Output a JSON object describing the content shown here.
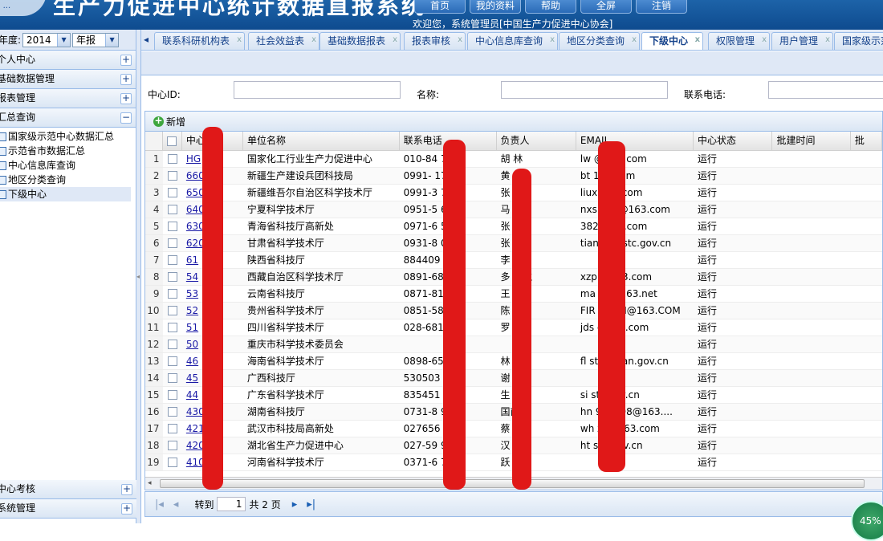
{
  "header": {
    "logo_text": "...",
    "app_title": "生产力促进中心统计数据直报系统",
    "welcome": "欢迎您，系统管理员[中国生产力促进中心协会]",
    "buttons": [
      "首页",
      "我的资料",
      "帮助",
      "全屏",
      "注销"
    ]
  },
  "sidebar": {
    "year_label": "年度:",
    "year_value": "2014",
    "report_type": "年报",
    "sections_top": [
      "个人中心",
      "基础数据管理",
      "报表管理",
      "汇总查询"
    ],
    "tree_items": [
      "国家级示范中心数据汇总",
      "示范省市数据汇总",
      "中心信息库查询",
      "地区分类查询",
      "下级中心"
    ],
    "selected_item": "下级中心",
    "sections_bottom": [
      "中心考核",
      "系统管理"
    ]
  },
  "tabs": [
    "联系科研机构表",
    "社会效益表",
    "基础数据报表",
    "报表审核",
    "中心信息库查询",
    "地区分类查询",
    "下级中心",
    "权限管理",
    "用户管理",
    "国家级示范"
  ],
  "active_tab": "下级中心",
  "search": {
    "id_label": "中心ID:",
    "name_label": "名称:",
    "phone_label": "联系电话:"
  },
  "toolbar": {
    "add_label": "新增"
  },
  "grid": {
    "columns": [
      "中心",
      "单位名称",
      "联系电话",
      "负责人",
      "EMAIL",
      "中心状态",
      "批建时间",
      "批"
    ],
    "rows": [
      {
        "n": "1",
        "id": "HG",
        "name": "国家化工行业生产力促进中心",
        "phone": "010-84 721",
        "person": "胡 林",
        "email": "lw @sina.com",
        "status": "运行"
      },
      {
        "n": "2",
        "id": "660",
        "name": "新疆生产建设兵团科技局",
        "phone": "0991- 170",
        "person": "黄",
        "email": "bt 126.com",
        "status": "运行"
      },
      {
        "n": "3",
        "id": "650",
        "name": "新疆维吾尔自治区科学技术厅",
        "phone": "0991-3 741",
        "person": "张 雷",
        "email": "liux 163.com",
        "status": "运行"
      },
      {
        "n": "4",
        "id": "640",
        "name": "宁夏科学技术厅",
        "phone": "0951-5 687",
        "person": "马 贵",
        "email": "nxs 821@163.com",
        "status": "运行"
      },
      {
        "n": "5",
        "id": "630",
        "name": "青海省科技厅高新处",
        "phone": "0971-6 505",
        "person": "张 满",
        "email": "382 @qq.com",
        "status": "运行"
      },
      {
        "n": "6",
        "id": "620",
        "name": "甘肃省科学技术厅",
        "phone": "0931-8 031",
        "person": "张 理",
        "email": "tian @gsstc.gov.cn",
        "status": "运行"
      },
      {
        "n": "7",
        "id": "61",
        "name": "陕西省科技厅",
        "phone": "884409",
        "person": "李 远",
        "email": "",
        "status": "运行"
      },
      {
        "n": "8",
        "id": "54",
        "name": "西藏自治区科学技术厅",
        "phone": "0891-68 71",
        "person": "多 次仁",
        "email": "xzp @163.com",
        "status": "运行"
      },
      {
        "n": "9",
        "id": "53",
        "name": "云南省科技厅",
        "phone": "0871-81 05",
        "person": "王 华",
        "email": "ma uy@163.net",
        "status": "运行"
      },
      {
        "n": "10",
        "id": "52",
        "name": "贵州省科学技术厅",
        "phone": "0851-584 32",
        "person": "陈",
        "email": "FIR EMCN@163.COM",
        "status": "运行"
      },
      {
        "n": "11",
        "id": "51",
        "name": "四川省科学技术厅",
        "phone": "028-681 39",
        "person": "罗 平",
        "email": "jds @163.com",
        "status": "运行"
      },
      {
        "n": "12",
        "id": "50",
        "name": "重庆市科学技术委员会",
        "phone": "",
        "person": "",
        "email": "",
        "status": "运行"
      },
      {
        "n": "13",
        "id": "46",
        "name": "海南省科学技术厅",
        "phone": "0898-65 525",
        "person": "林 梁",
        "email": "fl st.hainan.gov.cn",
        "status": "运行"
      },
      {
        "n": "14",
        "id": "45",
        "name": "广西科技厅",
        "phone": "530503",
        "person": "谢 堂",
        "email": "",
        "status": "运行"
      },
      {
        "n": "15",
        "id": "44",
        "name": "广东省科学技术厅",
        "phone": "835451 925",
        "person": "生",
        "email": "si stc.gov.cn",
        "status": "运行"
      },
      {
        "n": "16",
        "id": "430",
        "name": "湖南省科技厅",
        "phone": "0731-8 98",
        "person": "国甫",
        "email": "hn 988998@163....",
        "status": "运行"
      },
      {
        "n": "17",
        "id": "421",
        "name": "武汉市科技局高新处",
        "phone": "027656 30",
        "person": "蔡 学",
        "email": "wh zx@163.com",
        "status": "运行"
      },
      {
        "n": "18",
        "id": "420",
        "name": "湖北省生产力促进中心",
        "phone": "027-59 91",
        "person": "汉",
        "email": "ht std.gov.cn",
        "status": "运行"
      },
      {
        "n": "19",
        "id": "410",
        "name": "河南省科学技术厅",
        "phone": "0371-6 717",
        "person": "跃",
        "email": "",
        "status": "运行"
      }
    ]
  },
  "pager": {
    "goto_label": "转到",
    "page_value": "1",
    "total_label": "共 2 页"
  },
  "zoom": "45%",
  "colors": {
    "accent": "#1d63a8",
    "panel": "#dfe8f6",
    "border": "#99bbe8",
    "redaction": "#e01818"
  }
}
